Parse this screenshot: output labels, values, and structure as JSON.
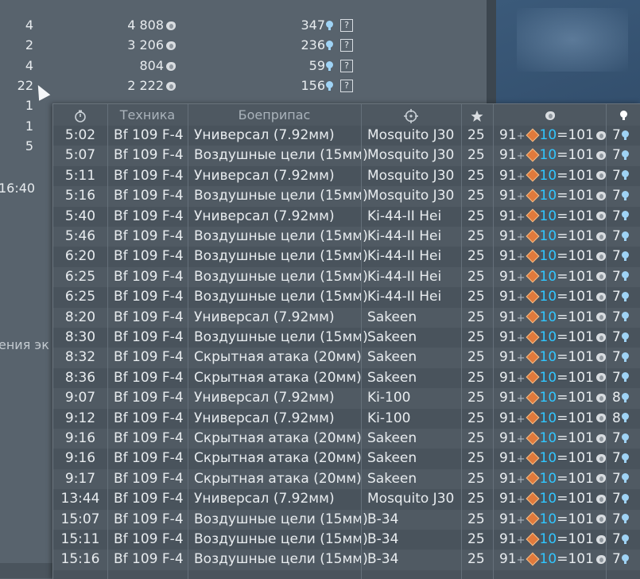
{
  "background_rows": [
    {
      "num": "4",
      "lions": "4 808",
      "rp": "347"
    },
    {
      "num": "2",
      "lions": "3 206",
      "rp": "236"
    },
    {
      "num": "4",
      "lions": "804",
      "rp": "59"
    },
    {
      "num": "22",
      "lions": "2 222",
      "rp": "156"
    },
    {
      "num": "1",
      "lions": "",
      "rp": ""
    },
    {
      "num": "1",
      "lions": "",
      "rp": ""
    },
    {
      "num": "5",
      "lions": "",
      "rp": ""
    }
  ],
  "background_time": "16:40",
  "background_partial_text": "ения эк",
  "help_icon_label": "?",
  "table": {
    "headers": {
      "time_icon": "stopwatch-icon",
      "vehicle": "Техника",
      "ammo": "Боеприпас",
      "target_icon": "crosshair-icon",
      "rank_icon": "star-icon",
      "lions_icon": "lion-icon",
      "rp_icon": "research-bulb-icon"
    },
    "rows": [
      {
        "time": "5:02",
        "vehicle": "Bf 109 F-4",
        "ammo": "Универсал (7.92мм)",
        "target": "Mosquito J30",
        "rank": "25",
        "base": "91",
        "bonus": "10",
        "total": "101",
        "rp": "7"
      },
      {
        "time": "5:07",
        "vehicle": "Bf 109 F-4",
        "ammo": "Воздушные цели (15мм)",
        "target": "Mosquito J30",
        "rank": "25",
        "base": "91",
        "bonus": "10",
        "total": "101",
        "rp": "7"
      },
      {
        "time": "5:11",
        "vehicle": "Bf 109 F-4",
        "ammo": "Универсал (7.92мм)",
        "target": "Mosquito J30",
        "rank": "25",
        "base": "91",
        "bonus": "10",
        "total": "101",
        "rp": "7"
      },
      {
        "time": "5:16",
        "vehicle": "Bf 109 F-4",
        "ammo": "Воздушные цели (15мм)",
        "target": "Mosquito J30",
        "rank": "25",
        "base": "91",
        "bonus": "10",
        "total": "101",
        "rp": "7"
      },
      {
        "time": "5:40",
        "vehicle": "Bf 109 F-4",
        "ammo": "Универсал (7.92мм)",
        "target": "Ki-44-II Hei",
        "rank": "25",
        "base": "91",
        "bonus": "10",
        "total": "101",
        "rp": "7"
      },
      {
        "time": "5:46",
        "vehicle": "Bf 109 F-4",
        "ammo": "Воздушные цели (15мм)",
        "target": "Ki-44-II Hei",
        "rank": "25",
        "base": "91",
        "bonus": "10",
        "total": "101",
        "rp": "7"
      },
      {
        "time": "6:20",
        "vehicle": "Bf 109 F-4",
        "ammo": "Воздушные цели (15мм)",
        "target": "Ki-44-II Hei",
        "rank": "25",
        "base": "91",
        "bonus": "10",
        "total": "101",
        "rp": "7"
      },
      {
        "time": "6:25",
        "vehicle": "Bf 109 F-4",
        "ammo": "Воздушные цели (15мм)",
        "target": "Ki-44-II Hei",
        "rank": "25",
        "base": "91",
        "bonus": "10",
        "total": "101",
        "rp": "7"
      },
      {
        "time": "6:25",
        "vehicle": "Bf 109 F-4",
        "ammo": "Воздушные цели (15мм)",
        "target": "Ki-44-II Hei",
        "rank": "25",
        "base": "91",
        "bonus": "10",
        "total": "101",
        "rp": "7"
      },
      {
        "time": "8:20",
        "vehicle": "Bf 109 F-4",
        "ammo": "Универсал (7.92мм)",
        "target": "Sakeen",
        "rank": "25",
        "base": "91",
        "bonus": "10",
        "total": "101",
        "rp": "7"
      },
      {
        "time": "8:30",
        "vehicle": "Bf 109 F-4",
        "ammo": "Воздушные цели (15мм)",
        "target": "Sakeen",
        "rank": "25",
        "base": "91",
        "bonus": "10",
        "total": "101",
        "rp": "7"
      },
      {
        "time": "8:32",
        "vehicle": "Bf 109 F-4",
        "ammo": "Скрытная атака (20мм)",
        "target": "Sakeen",
        "rank": "25",
        "base": "91",
        "bonus": "10",
        "total": "101",
        "rp": "7"
      },
      {
        "time": "8:36",
        "vehicle": "Bf 109 F-4",
        "ammo": "Скрытная атака (20мм)",
        "target": "Sakeen",
        "rank": "25",
        "base": "91",
        "bonus": "10",
        "total": "101",
        "rp": "7"
      },
      {
        "time": "9:07",
        "vehicle": "Bf 109 F-4",
        "ammo": "Универсал (7.92мм)",
        "target": "Ki-100",
        "rank": "25",
        "base": "91",
        "bonus": "10",
        "total": "101",
        "rp": "8"
      },
      {
        "time": "9:12",
        "vehicle": "Bf 109 F-4",
        "ammo": "Универсал (7.92мм)",
        "target": "Ki-100",
        "rank": "25",
        "base": "91",
        "bonus": "10",
        "total": "101",
        "rp": "8"
      },
      {
        "time": "9:16",
        "vehicle": "Bf 109 F-4",
        "ammo": "Скрытная атака (20мм)",
        "target": "Sakeen",
        "rank": "25",
        "base": "91",
        "bonus": "10",
        "total": "101",
        "rp": "7"
      },
      {
        "time": "9:16",
        "vehicle": "Bf 109 F-4",
        "ammo": "Скрытная атака (20мм)",
        "target": "Sakeen",
        "rank": "25",
        "base": "91",
        "bonus": "10",
        "total": "101",
        "rp": "7"
      },
      {
        "time": "9:17",
        "vehicle": "Bf 109 F-4",
        "ammo": "Скрытная атака (20мм)",
        "target": "Sakeen",
        "rank": "25",
        "base": "91",
        "bonus": "10",
        "total": "101",
        "rp": "7"
      },
      {
        "time": "13:44",
        "vehicle": "Bf 109 F-4",
        "ammo": "Универсал (7.92мм)",
        "target": "Mosquito J30",
        "rank": "25",
        "base": "91",
        "bonus": "10",
        "total": "101",
        "rp": "7"
      },
      {
        "time": "15:07",
        "vehicle": "Bf 109 F-4",
        "ammo": "Воздушные цели (15мм)",
        "target": "B-34",
        "rank": "25",
        "base": "91",
        "bonus": "10",
        "total": "101",
        "rp": "7"
      },
      {
        "time": "15:11",
        "vehicle": "Bf 109 F-4",
        "ammo": "Воздушные цели (15мм)",
        "target": "B-34",
        "rank": "25",
        "base": "91",
        "bonus": "10",
        "total": "101",
        "rp": "7"
      },
      {
        "time": "15:16",
        "vehicle": "Bf 109 F-4",
        "ammo": "Воздушные цели (15мм)",
        "target": "B-34",
        "rank": "25",
        "base": "91",
        "bonus": "10",
        "total": "101",
        "rp": "7"
      }
    ]
  },
  "colors": {
    "bonus_blue": "#30c6ff",
    "gem_orange": "#e07a3c",
    "rp_bulb": "#9fd3f5"
  }
}
